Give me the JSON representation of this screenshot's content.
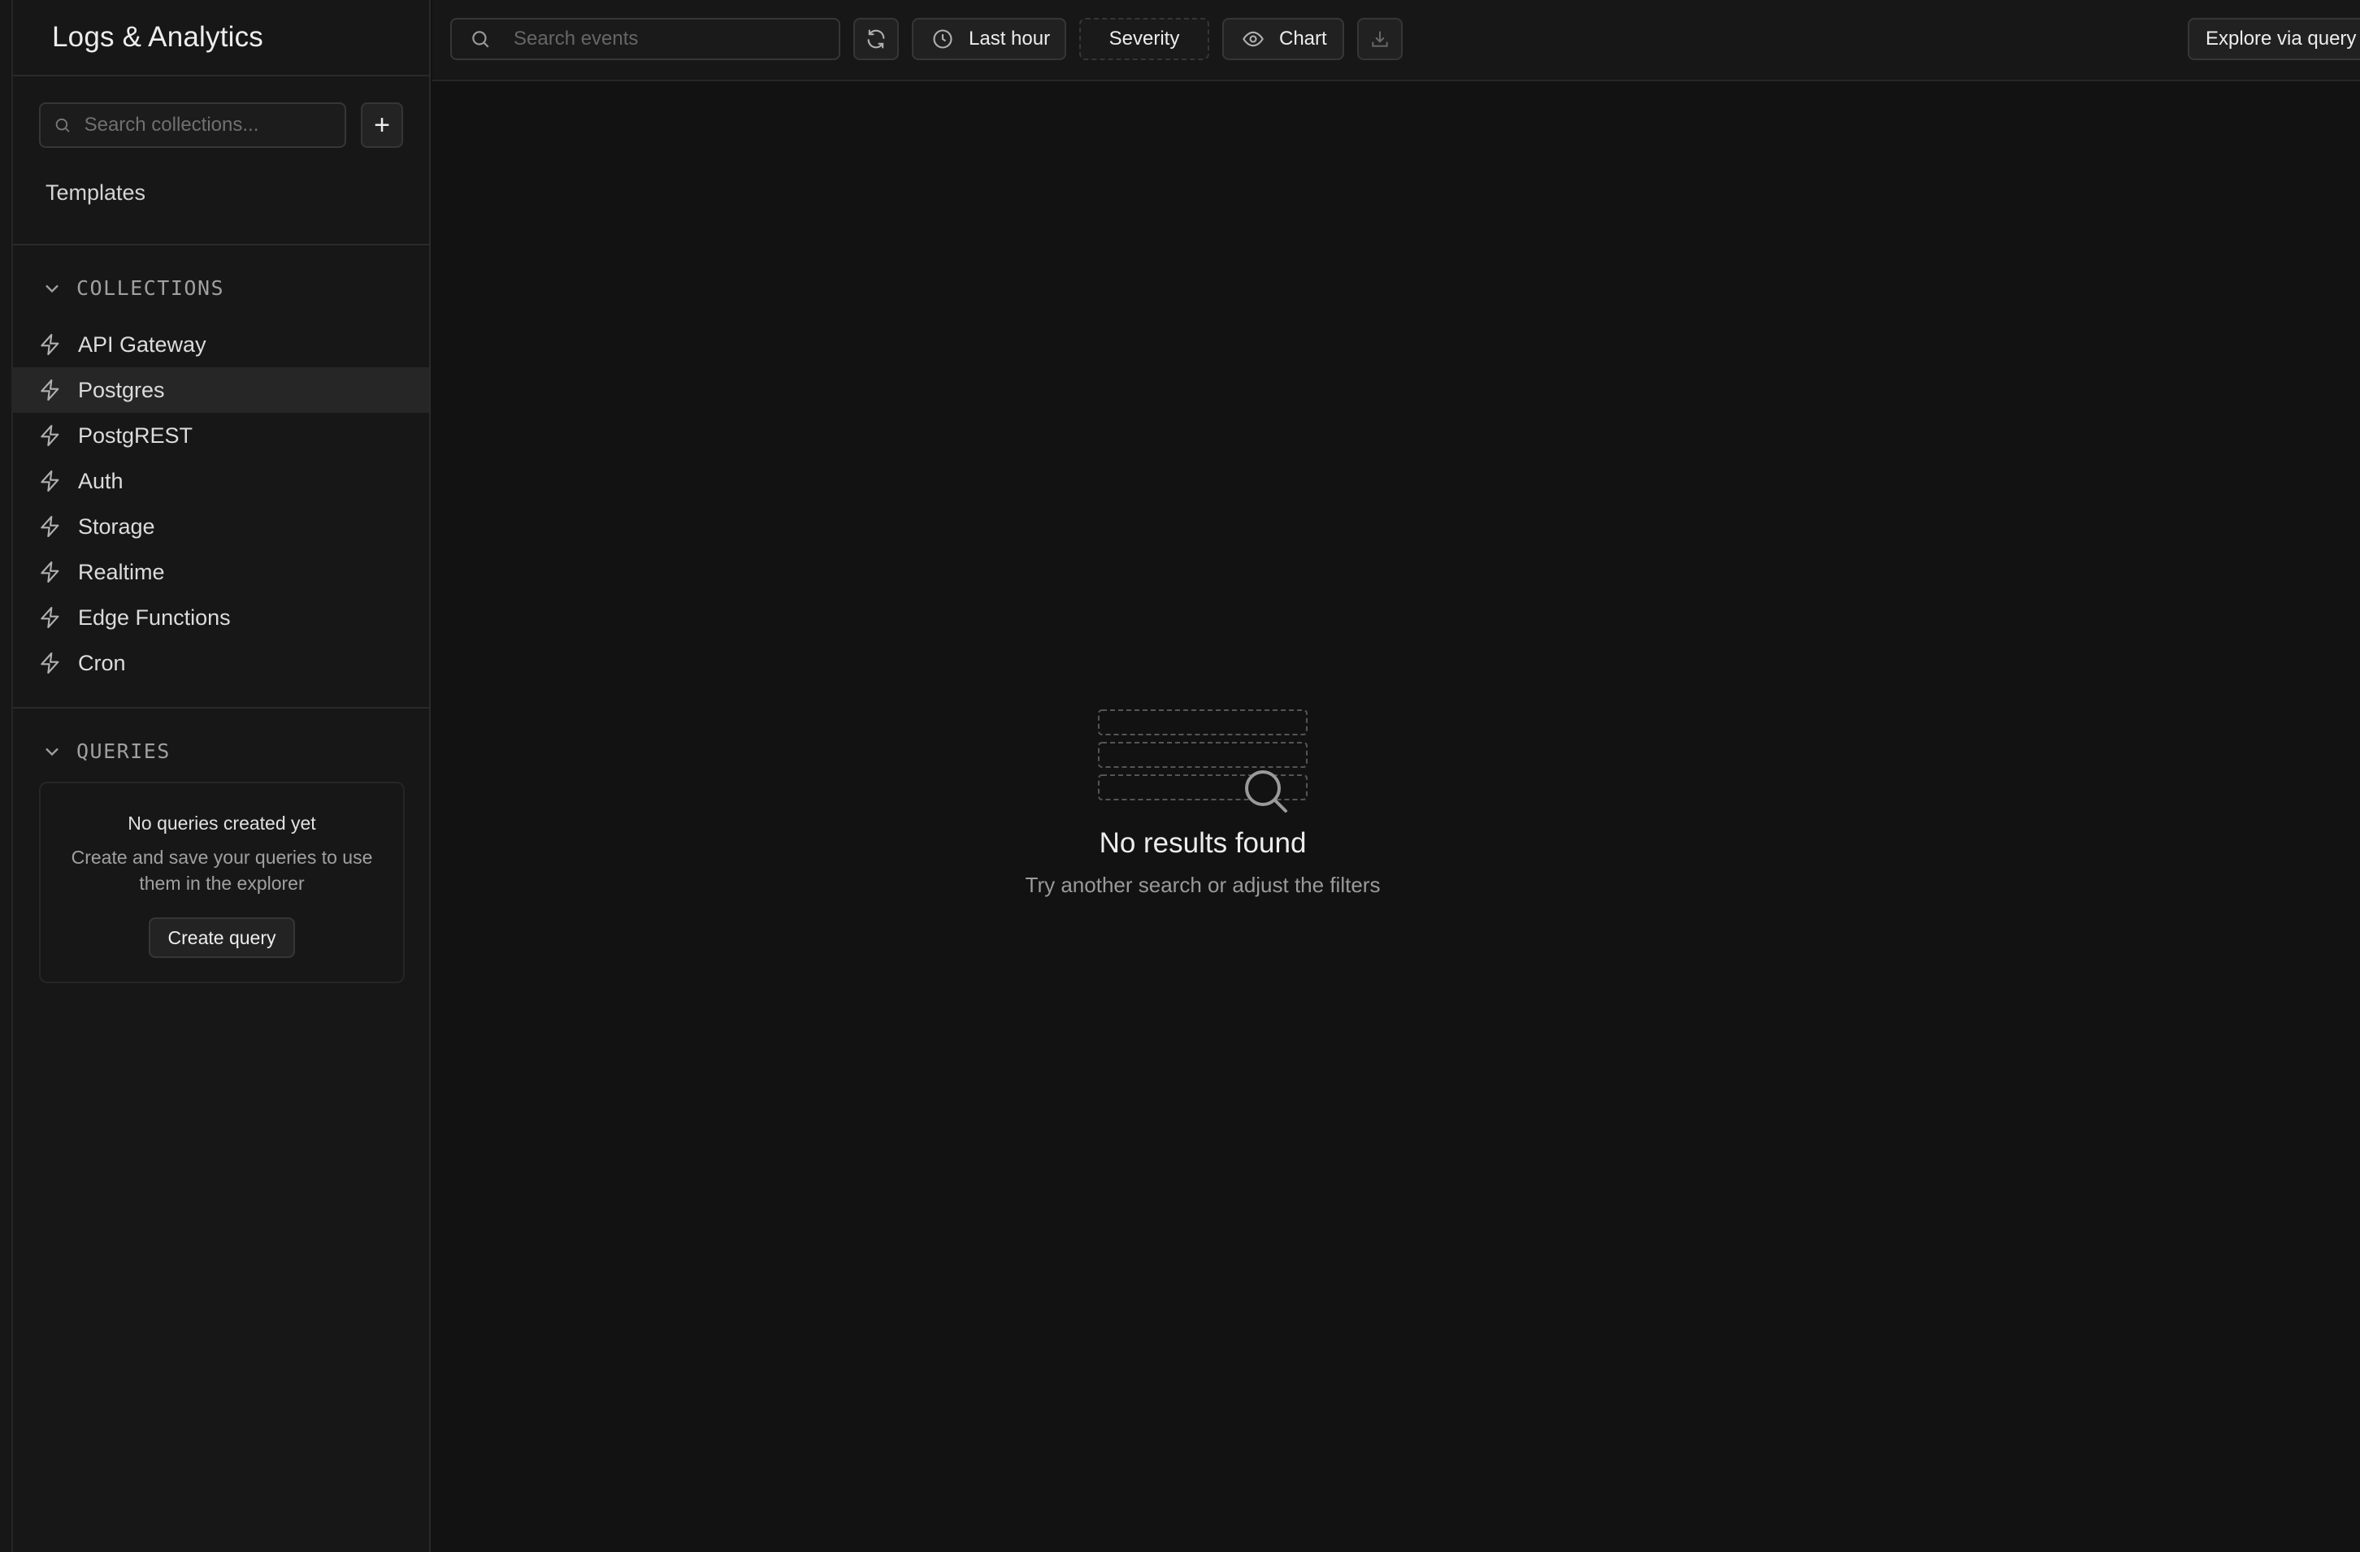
{
  "sidebar": {
    "title": "Logs & Analytics",
    "search_placeholder": "Search collections...",
    "add_label": "+",
    "templates_label": "Templates",
    "collections_header": "COLLECTIONS",
    "collections": [
      {
        "label": "API Gateway",
        "icon": "bolt-icon"
      },
      {
        "label": "Postgres",
        "icon": "bolt-icon",
        "active": true
      },
      {
        "label": "PostgREST",
        "icon": "bolt-icon"
      },
      {
        "label": "Auth",
        "icon": "bolt-icon"
      },
      {
        "label": "Storage",
        "icon": "bolt-icon"
      },
      {
        "label": "Realtime",
        "icon": "bolt-icon"
      },
      {
        "label": "Edge Functions",
        "icon": "bolt-icon"
      },
      {
        "label": "Cron",
        "icon": "bolt-icon"
      }
    ],
    "queries_header": "QUERIES",
    "queries_empty": {
      "title": "No queries created yet",
      "description": "Create and save your queries to use them in the explorer",
      "button": "Create query"
    }
  },
  "toolbar": {
    "search_placeholder": "Search events",
    "time_range": "Last hour",
    "severity": "Severity",
    "chart": "Chart",
    "explore": "Explore via query"
  },
  "empty_state": {
    "title": "No results found",
    "subtitle": "Try another search or adjust the filters"
  },
  "colors": {
    "background": "#121212",
    "panel": "#171717",
    "border": "#2a2a2a",
    "text": "#ededed",
    "muted": "#9a9a9a"
  }
}
